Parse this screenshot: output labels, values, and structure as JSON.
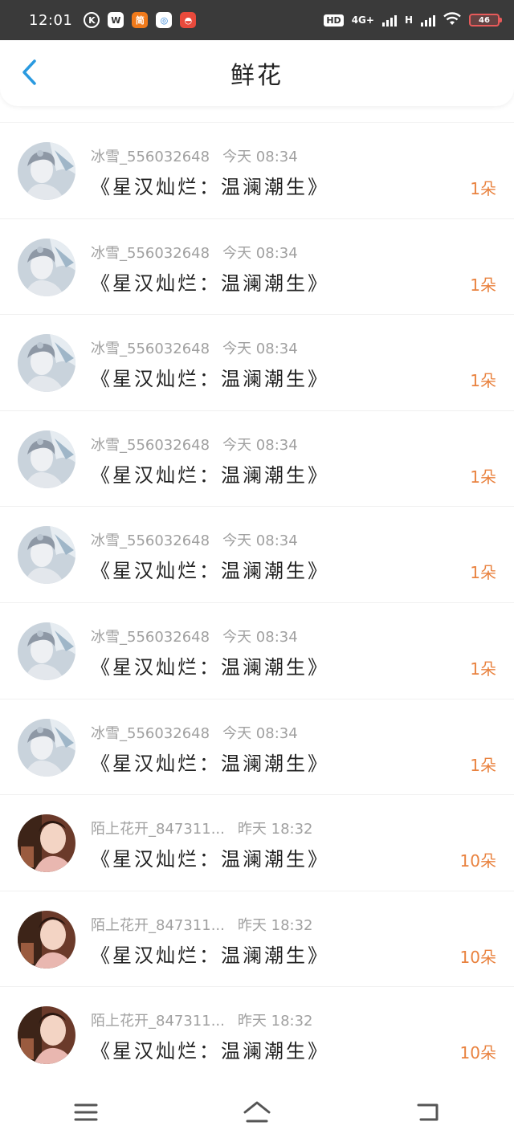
{
  "status_bar": {
    "time": "12:01",
    "apps": [
      {
        "icon": "k-app-icon",
        "label": "K"
      },
      {
        "icon": "wechat-icon",
        "label": "W"
      },
      {
        "icon": "orange-app-icon",
        "label": "简"
      },
      {
        "icon": "blue-app-icon",
        "label": "◎"
      },
      {
        "icon": "red-app-icon",
        "label": "◓"
      }
    ],
    "hd": "HD",
    "network_4g": "4G+",
    "network_h": "H",
    "battery": "46"
  },
  "header": {
    "title": "鲜花",
    "back_icon": "chevron-left-icon"
  },
  "colors": {
    "accent": "#2a9ae0",
    "count": "#e9823f",
    "meta": "#a0a0a0"
  },
  "rows": [
    {
      "user": "冰雪_556032648",
      "time": "今天 08:34",
      "book": "《星汉灿烂：温澜潮生》",
      "count": "1朵",
      "avatar": "girl-avatar-light"
    },
    {
      "user": "冰雪_556032648",
      "time": "今天 08:34",
      "book": "《星汉灿烂：温澜潮生》",
      "count": "1朵",
      "avatar": "girl-avatar-light"
    },
    {
      "user": "冰雪_556032648",
      "time": "今天 08:34",
      "book": "《星汉灿烂：温澜潮生》",
      "count": "1朵",
      "avatar": "girl-avatar-light"
    },
    {
      "user": "冰雪_556032648",
      "time": "今天 08:34",
      "book": "《星汉灿烂：温澜潮生》",
      "count": "1朵",
      "avatar": "girl-avatar-light"
    },
    {
      "user": "冰雪_556032648",
      "time": "今天 08:34",
      "book": "《星汉灿烂：温澜潮生》",
      "count": "1朵",
      "avatar": "girl-avatar-light"
    },
    {
      "user": "冰雪_556032648",
      "time": "今天 08:34",
      "book": "《星汉灿烂：温澜潮生》",
      "count": "1朵",
      "avatar": "girl-avatar-light"
    },
    {
      "user": "冰雪_556032648",
      "time": "今天 08:34",
      "book": "《星汉灿烂：温澜潮生》",
      "count": "1朵",
      "avatar": "girl-avatar-light"
    },
    {
      "user": "陌上花开_847311...",
      "time": "昨天 18:32",
      "book": "《星汉灿烂：温澜潮生》",
      "count": "10朵",
      "avatar": "girl-avatar-warm"
    },
    {
      "user": "陌上花开_847311...",
      "time": "昨天 18:32",
      "book": "《星汉灿烂：温澜潮生》",
      "count": "10朵",
      "avatar": "girl-avatar-warm"
    },
    {
      "user": "陌上花开_847311...",
      "time": "昨天 18:32",
      "book": "《星汉灿烂：温澜潮生》",
      "count": "10朵",
      "avatar": "girl-avatar-warm"
    }
  ],
  "nav": {
    "menu_icon": "menu-icon",
    "home_icon": "home-icon",
    "back_icon": "back-icon"
  }
}
